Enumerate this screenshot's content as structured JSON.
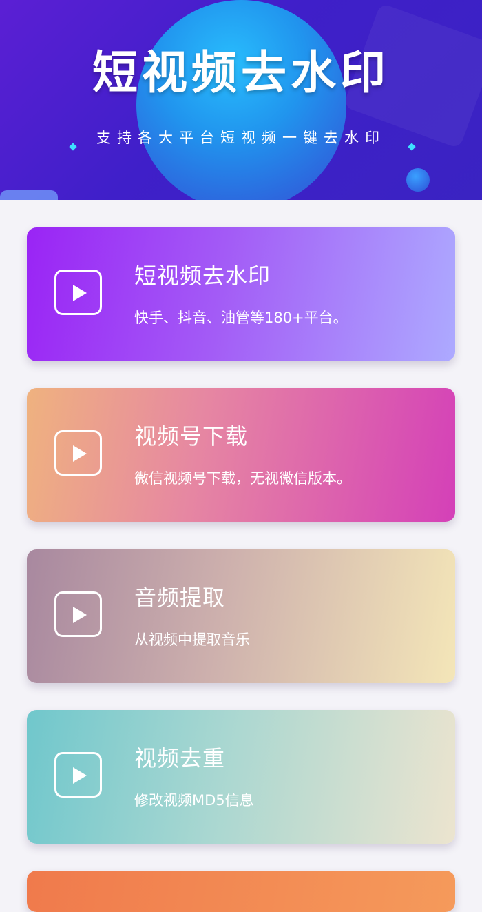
{
  "header": {
    "title": "短视频去水印",
    "subtitle": "支持各大平台短视频一键去水印"
  },
  "cards": [
    {
      "title": "短视频去水印",
      "desc": "快手、抖音、油管等180+平台。",
      "icon": "play-icon"
    },
    {
      "title": "视频号下载",
      "desc": "微信视频号下载，无视微信版本。",
      "icon": "play-icon"
    },
    {
      "title": "音频提取",
      "desc": "从视频中提取音乐",
      "icon": "play-icon"
    },
    {
      "title": "视频去重",
      "desc": "修改视频MD5信息",
      "icon": "play-icon"
    }
  ],
  "colors": {
    "banner": "#3f1fc9",
    "background": "#f4f3f8"
  }
}
